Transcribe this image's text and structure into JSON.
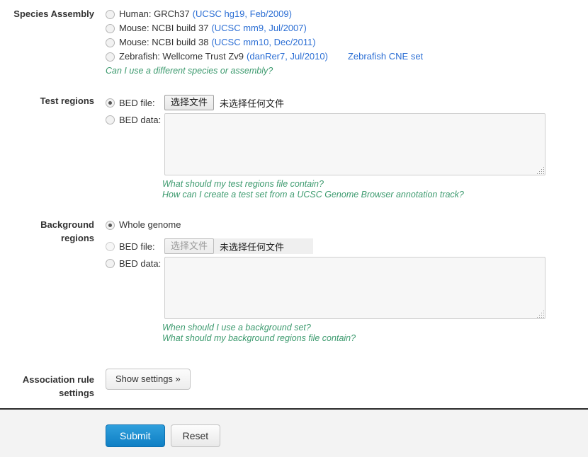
{
  "species": {
    "label": "Species Assembly",
    "options": [
      {
        "name": "Human: GRCh37",
        "assembly": "(UCSC hg19, Feb/2009)",
        "checked": false
      },
      {
        "name": "Mouse: NCBI build 37",
        "assembly": "(UCSC mm9, Jul/2007)",
        "checked": false
      },
      {
        "name": "Mouse: NCBI build 38",
        "assembly": "(UCSC mm10, Dec/2011)",
        "checked": false
      },
      {
        "name": "Zebrafish: Wellcome Trust Zv9",
        "assembly": "(danRer7, Jul/2010)",
        "checked": false,
        "extra_link": "Zebrafish CNE set"
      }
    ],
    "help": "Can I use a different species or assembly?"
  },
  "test_regions": {
    "label": "Test regions",
    "file_option_label": "BED file:",
    "file_option_checked": true,
    "file_button_label": "选择文件",
    "file_status_text": "未选择任何文件",
    "data_option_label": "BED data:",
    "data_option_checked": false,
    "textarea_value": "",
    "help_1": "What should my test regions file contain?",
    "help_2": "How can I create a test set from a UCSC Genome Browser annotation track?"
  },
  "background_regions": {
    "label_line_1": "Background",
    "label_line_2": "regions",
    "whole_genome_label": "Whole genome",
    "whole_genome_checked": true,
    "file_option_label": "BED file:",
    "file_option_checked": false,
    "file_disabled": true,
    "file_button_label": "选择文件",
    "file_status_text": "未选择任何文件",
    "data_option_label": "BED data:",
    "data_option_checked": false,
    "textarea_value": "",
    "help_1": "When should I use a background set?",
    "help_2": "What should my background regions file contain?"
  },
  "association_rule": {
    "label_line_1": "Association rule",
    "label_line_2": "settings",
    "button_label": "Show settings »"
  },
  "footer": {
    "submit_label": "Submit",
    "reset_label": "Reset"
  },
  "colors": {
    "link_blue": "#2b6ed4",
    "help_green": "#3c9a6e",
    "submit_blue": "#0f7fc4",
    "footer_bg": "#f3f3f3"
  }
}
